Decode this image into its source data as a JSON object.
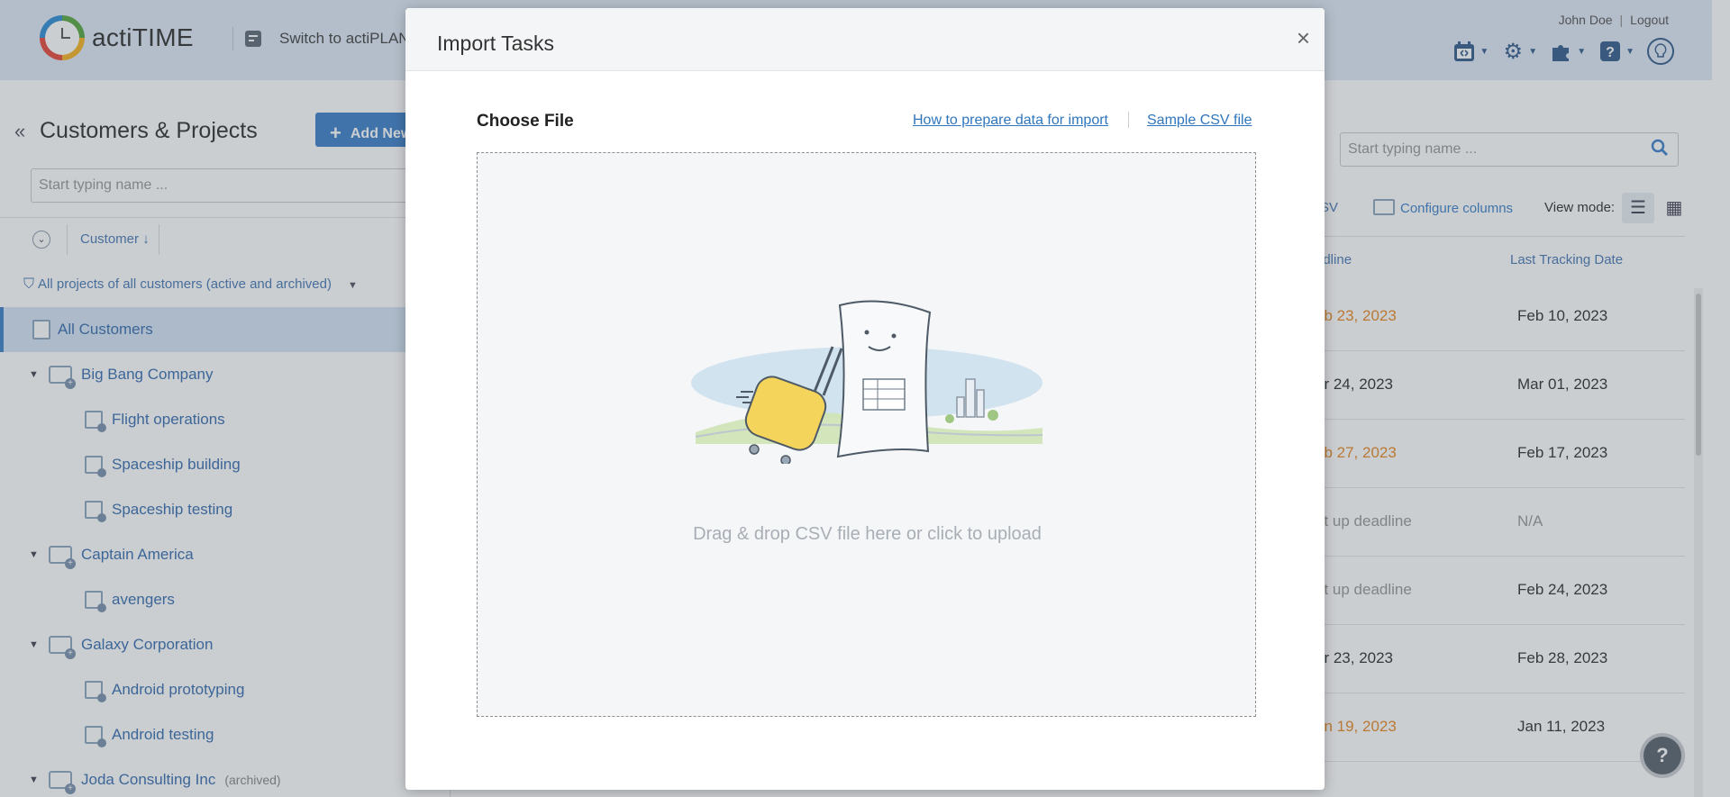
{
  "header": {
    "app_name": "actiTIME",
    "switch_label": "Switch to actiPLAN",
    "user_name": "John Doe",
    "logout_label": "Logout",
    "icons": [
      "calendar-icon",
      "gear-icon",
      "puzzle-icon",
      "help-icon",
      "bulb-icon"
    ]
  },
  "left_panel": {
    "title": "Customers & Projects",
    "add_new_label": "Add New",
    "search_placeholder": "Start typing name ...",
    "sort_label": "Customer",
    "filter_label": "All projects of all customers (active and archived)",
    "all_customers_label": "All Customers",
    "tree": [
      {
        "type": "customer",
        "label": "Big Bang Company"
      },
      {
        "type": "project",
        "label": "Flight operations"
      },
      {
        "type": "project",
        "label": "Spaceship building"
      },
      {
        "type": "project",
        "label": "Spaceship testing"
      },
      {
        "type": "customer",
        "label": "Captain America"
      },
      {
        "type": "project",
        "label": "avengers"
      },
      {
        "type": "customer",
        "label": "Galaxy Corporation"
      },
      {
        "type": "project",
        "label": "Android prototyping"
      },
      {
        "type": "project",
        "label": "Android testing"
      },
      {
        "type": "customer",
        "label": "Joda Consulting Inc",
        "archived": "(archived)"
      }
    ]
  },
  "right_panel": {
    "search_placeholder": "Start typing name ...",
    "csv_fragment": "SV",
    "configure_columns_label": "Configure columns",
    "view_mode_label": "View mode:",
    "columns": {
      "deadline": "adline",
      "last_tracking": "Last Tracking Date"
    },
    "rows": [
      {
        "deadline": "eb 23, 2023",
        "deadline_style": "orange",
        "last": "Feb 10, 2023"
      },
      {
        "deadline": "ar 24, 2023",
        "deadline_style": "normal",
        "last": "Mar 01, 2023"
      },
      {
        "deadline": "eb 27, 2023",
        "deadline_style": "orange",
        "last": "Feb 17, 2023"
      },
      {
        "deadline": "et up deadline",
        "deadline_style": "gray",
        "last": "N/A"
      },
      {
        "deadline": "et up deadline",
        "deadline_style": "gray",
        "last": "Feb 24, 2023"
      },
      {
        "deadline": "ar 23, 2023",
        "deadline_style": "normal",
        "last": "Feb 28, 2023"
      },
      {
        "deadline": "an 19, 2023",
        "deadline_style": "orange",
        "last": "Jan 11, 2023"
      }
    ],
    "help_label": "?"
  },
  "modal": {
    "title": "Import Tasks",
    "close_label": "×",
    "choose_file_label": "Choose File",
    "how_to_link": "How to prepare data for import",
    "sample_link": "Sample CSV file",
    "drop_text": "Drag & drop CSV file here or click to upload"
  },
  "colors": {
    "accent": "#3f82c9",
    "link": "#2f76bd",
    "overdue": "#e88a26",
    "header_bg": "#dfe9f5"
  }
}
